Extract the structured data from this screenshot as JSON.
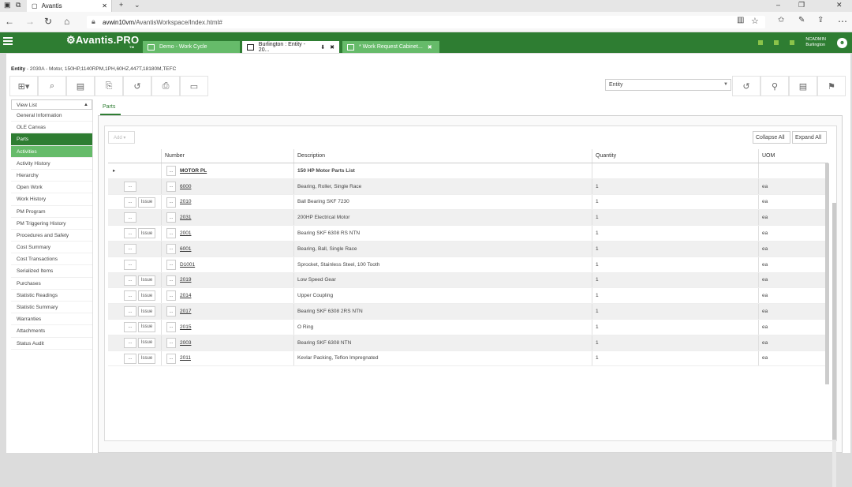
{
  "browser": {
    "tab_title": "Avantis",
    "url_host": "avwin10vm",
    "url_path": "/AvantisWorkspace/Index.html#"
  },
  "app": {
    "logo": "Avantis.PRO",
    "logo_tm": "TM",
    "tabs": [
      {
        "label": "Demo - Work Cycle"
      },
      {
        "label": "Burlington : Entity - 20..."
      },
      {
        "label": "* Work Request Cabinet..."
      }
    ],
    "user": {
      "name": "NCADMIN",
      "site": "Burlington"
    }
  },
  "breadcrumb": {
    "entity_label": "Entity",
    "detail": " - 2030A - Motor, 150HP,1140RPM,1PH,60HZ,447T,18180M,TEFC"
  },
  "entity_select": {
    "value": "Entity"
  },
  "sidebar": {
    "view_list": "View List",
    "items": [
      {
        "label": "General Information"
      },
      {
        "label": "OLE Canvas"
      },
      {
        "label": "Parts"
      },
      {
        "label": "Activities"
      },
      {
        "label": "Activity History"
      },
      {
        "label": "Hierarchy"
      },
      {
        "label": "Open Work"
      },
      {
        "label": "Work History"
      },
      {
        "label": "PM Program"
      },
      {
        "label": "PM Triggering History"
      },
      {
        "label": "Procedures and Safety"
      },
      {
        "label": "Cost Summary"
      },
      {
        "label": "Cost Transactions"
      },
      {
        "label": "Serialized Items"
      },
      {
        "label": "Purchases"
      },
      {
        "label": "Statistic Readings"
      },
      {
        "label": "Statistic Summary"
      },
      {
        "label": "Warranties"
      },
      {
        "label": "Attachments"
      },
      {
        "label": "Status Audit"
      }
    ]
  },
  "main": {
    "tab": "Parts",
    "add": "Add",
    "collapse_all": "Collapse All",
    "expand_all": "Expand All",
    "columns": [
      "Number",
      "Description",
      "Quantity",
      "UOM"
    ],
    "ellipsis": "...",
    "issue": "Issue",
    "expander": "▸",
    "rows": [
      {
        "number": "MOTOR PL",
        "description": "150 HP Motor Parts List",
        "quantity": "",
        "uom": "",
        "issue": false,
        "group": true
      },
      {
        "number": "6000",
        "description": "Bearing, Roller, Single Race",
        "quantity": "1",
        "uom": "ea",
        "issue": false
      },
      {
        "number": "2010",
        "description": "Ball Bearing SKF 7230",
        "quantity": "1",
        "uom": "ea",
        "issue": true
      },
      {
        "number": "2031",
        "description": "200HP Electrical Motor",
        "quantity": "1",
        "uom": "ea",
        "issue": false
      },
      {
        "number": "2001",
        "description": "Bearing SKF 6308 RS NTN",
        "quantity": "1",
        "uom": "ea",
        "issue": true
      },
      {
        "number": "6001",
        "description": "Bearing, Ball, Single Race",
        "quantity": "1",
        "uom": "ea",
        "issue": false
      },
      {
        "number": "D1001",
        "description": "Sprocket, Stainless Steel, 100 Tooth",
        "quantity": "1",
        "uom": "ea",
        "issue": false
      },
      {
        "number": "2019",
        "description": "Low Speed Gear",
        "quantity": "1",
        "uom": "ea",
        "issue": true
      },
      {
        "number": "2014",
        "description": "Upper Coupling",
        "quantity": "1",
        "uom": "ea",
        "issue": true
      },
      {
        "number": "2017",
        "description": "Bearing SKF 6308 2RS NTN",
        "quantity": "1",
        "uom": "ea",
        "issue": true
      },
      {
        "number": "2015",
        "description": "O Ring",
        "quantity": "1",
        "uom": "ea",
        "issue": true
      },
      {
        "number": "2003",
        "description": "Bearing SKF 6308 NTN",
        "quantity": "1",
        "uom": "ea",
        "issue": true
      },
      {
        "number": "2011",
        "description": "Kevlar Packing, Teflon Impregnated",
        "quantity": "1",
        "uom": "ea",
        "issue": true
      }
    ]
  },
  "colors": {
    "brand_green": "#2e7d32",
    "light_green": "#66bb6a"
  },
  "icons": [
    "menu-icon",
    "back-icon",
    "forward-icon",
    "refresh-icon",
    "home-icon",
    "lock-icon",
    "star-icon",
    "new-icon",
    "zoom-icon",
    "copy-icon",
    "export-icon",
    "undo-icon",
    "print-icon",
    "screen-icon",
    "pin-icon",
    "doc-icon",
    "bookmark-icon"
  ]
}
